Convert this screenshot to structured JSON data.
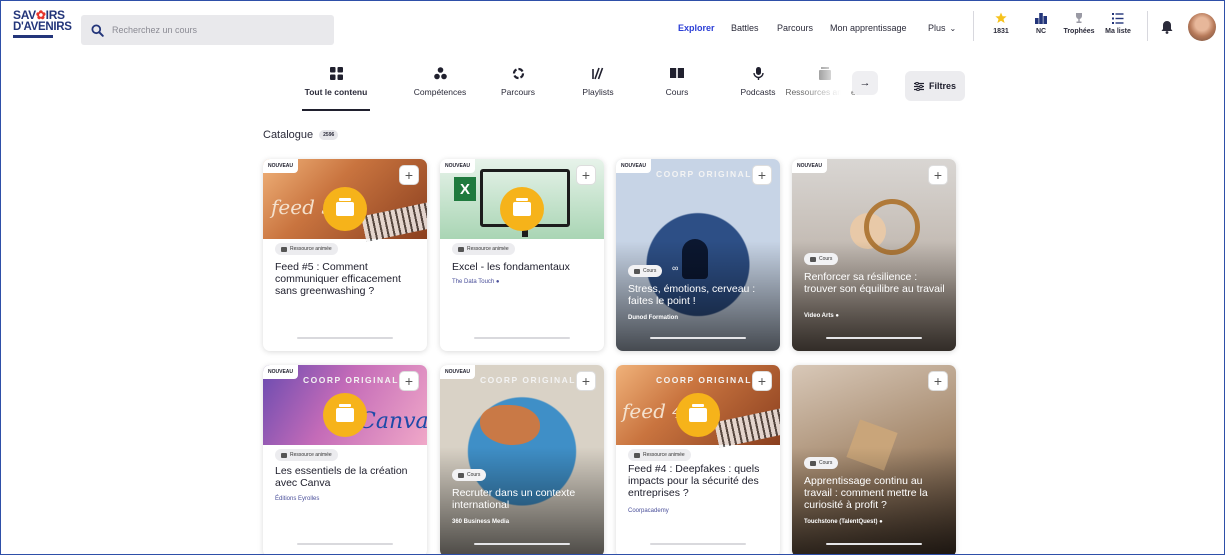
{
  "brand": {
    "line1": "SAV",
    "line1b": "IRS",
    "line2": "D'AVENIRS"
  },
  "search": {
    "placeholder": "Recherchez un cours"
  },
  "nav": {
    "explorer": "Explorer",
    "battles": "Battles",
    "parcours": "Parcours",
    "apprentissage": "Mon apprentissage",
    "plus": "Plus"
  },
  "stats": {
    "stars": "1831",
    "rank": "NC",
    "trophies": "Trophées",
    "list": "Ma liste"
  },
  "tabs": [
    "Tout le contenu",
    "Compétences",
    "Parcours",
    "Playlists",
    "Cours",
    "Podcasts",
    "Ressources animées"
  ],
  "filters": "Filtres",
  "catalog": {
    "label": "Catalogue",
    "count": "2596"
  },
  "labels": {
    "new": "NOUVEAU",
    "coorp": "COORP ORIGINAL",
    "resource": "Ressource animée",
    "course": "Cours"
  },
  "cards": [
    {
      "title": "Feed #5 : Comment communiquer efficacement sans greenwashing ?",
      "author": "",
      "thumb_text": "feed 5"
    },
    {
      "title": "Excel - les fondamentaux",
      "author": "The Data Touch",
      "thumb_text": "X"
    },
    {
      "title": "Stress, émotions, cerveau : faites le point !",
      "author": "Dunod Formation"
    },
    {
      "title": "Renforcer sa résilience : trouver son équilibre au travail",
      "author": "Video Arts"
    },
    {
      "title": "Les essentiels de la création avec Canva",
      "author": "Éditions Eyrolles",
      "thumb_text": "Canva"
    },
    {
      "title": "Recruter dans un contexte international",
      "author": "360 Business Media"
    },
    {
      "title": "Feed #4 : Deepfakes : quels impacts pour la sécurité des entreprises ?",
      "author": "Coorpacademy",
      "thumb_text": "feed 4"
    },
    {
      "title": "Apprentissage continu au travail : comment mettre la curiosité à profit ?",
      "author": "Touchstone (TalentQuest)"
    }
  ],
  "colors": {
    "accent": "#2b3ed6",
    "resource": "#f6b31a",
    "brand": "#23357a"
  }
}
